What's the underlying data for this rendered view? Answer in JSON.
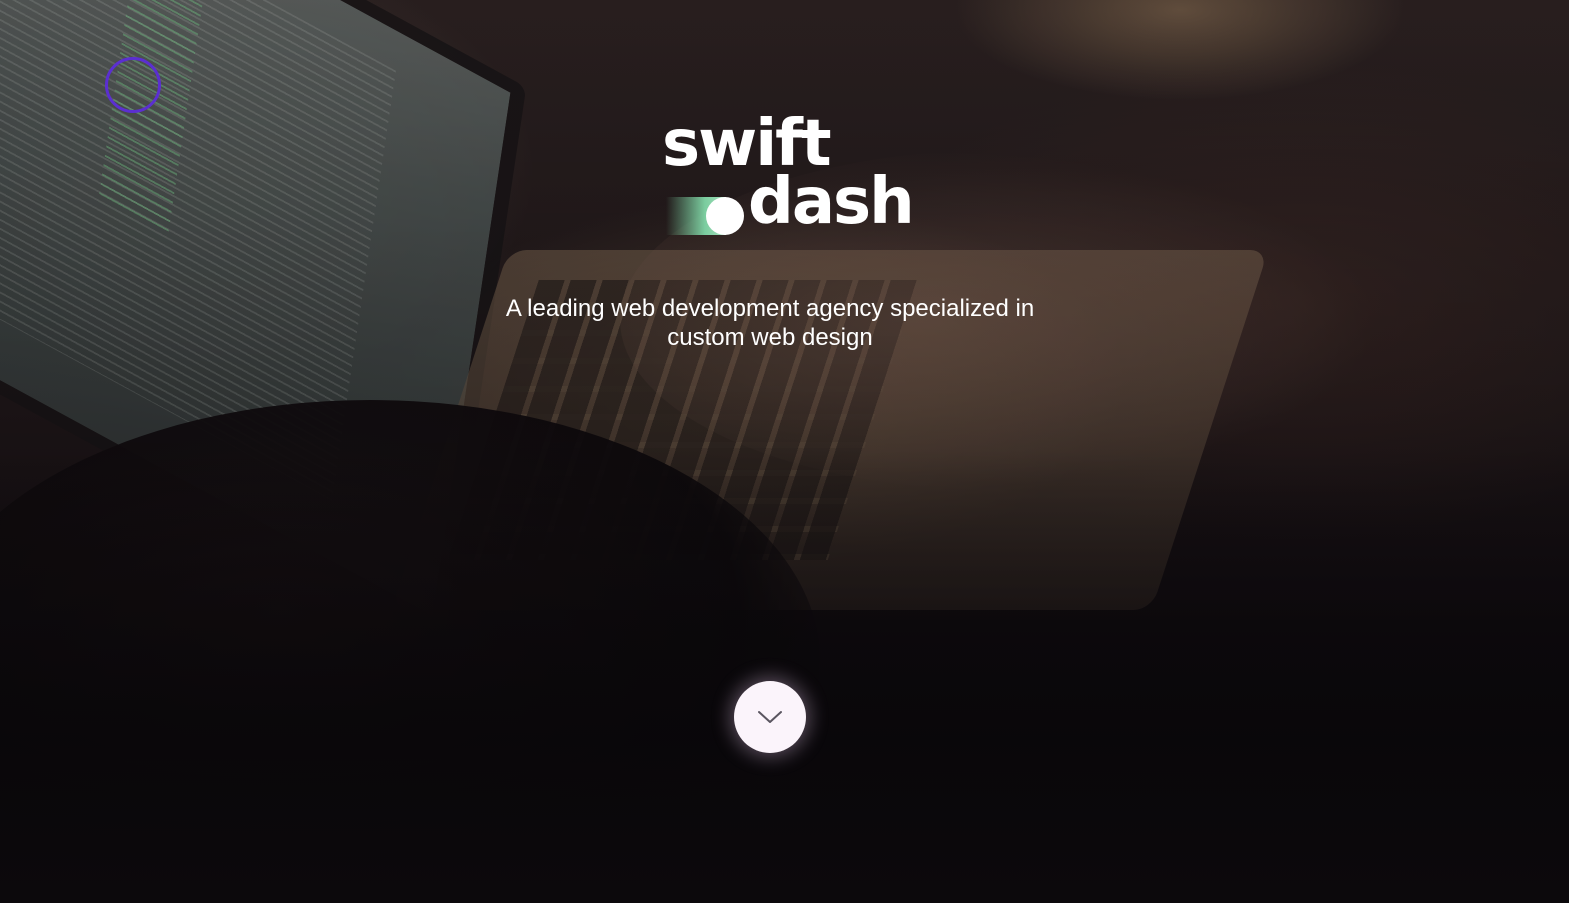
{
  "logo": {
    "line1": "swift",
    "line2": "dash",
    "mark_color": "#7bcd9f"
  },
  "hero": {
    "tagline": "A leading web development agency specialized in custom web design"
  },
  "scroll_button": {
    "icon": "chevron-down-icon"
  },
  "colors": {
    "background": "#0d0a0d",
    "cursor_ring": "#5b2fd1",
    "button_bg": "#fbf4fb",
    "text": "#ffffff"
  }
}
